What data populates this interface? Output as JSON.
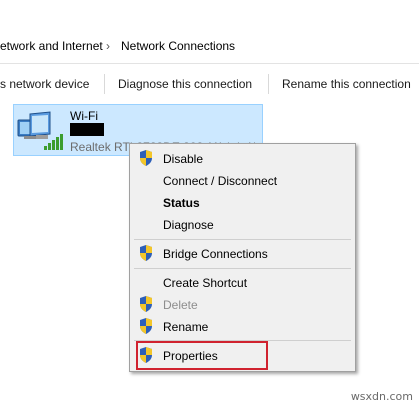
{
  "breadcrumb": {
    "item1": "etwork and Internet",
    "item2": "Network Connections",
    "separator": "›"
  },
  "toolbar": {
    "item1": "s network device",
    "item2": "Diagnose this connection",
    "item3": "Rename this connection"
  },
  "adapter": {
    "name": "Wi-Fi",
    "device": "Realtek RTL8723DE 802.11b/g/n Wi-"
  },
  "context_menu": {
    "items": [
      {
        "label": "Disable"
      },
      {
        "label": "Connect / Disconnect"
      },
      {
        "label": "Status"
      },
      {
        "label": "Diagnose"
      },
      {
        "label": "Bridge Connections"
      },
      {
        "label": "Create Shortcut"
      },
      {
        "label": "Delete"
      },
      {
        "label": "Rename"
      },
      {
        "label": "Properties"
      }
    ]
  },
  "colors": {
    "selection_bg": "#cce8ff",
    "selection_border": "#99d1ff",
    "highlight_red": "#d0222f",
    "menu_bg": "#f0f0f0"
  },
  "icons": {
    "adapter": "network-adapter-icon",
    "signal": "wifi-signal-icon",
    "shield": "uac-shield-icon"
  },
  "watermark": "wsxdn.com"
}
